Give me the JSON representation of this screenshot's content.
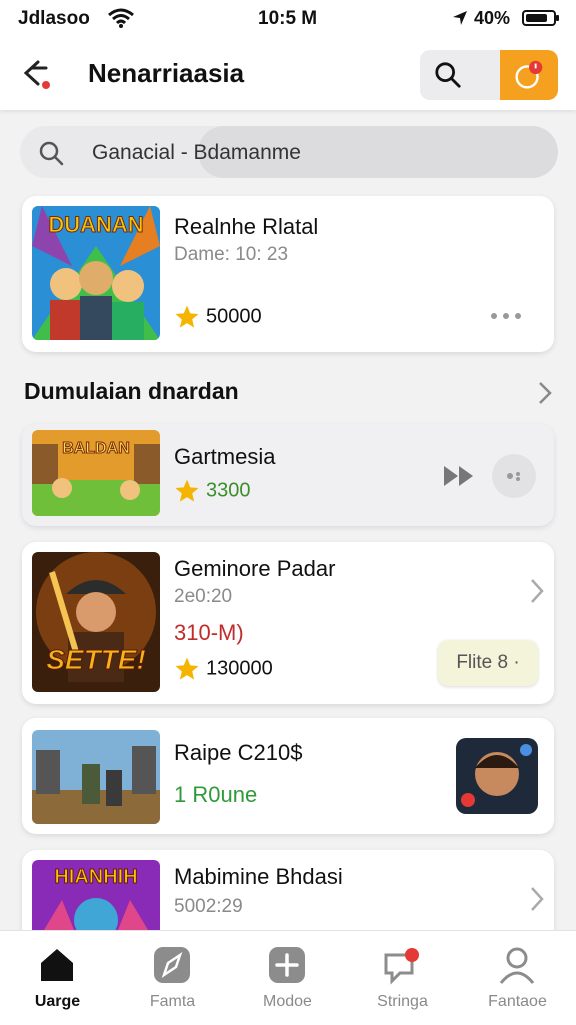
{
  "status_bar": {
    "carrier": "Jdlasoo",
    "time": "10:5 M",
    "battery": "40%",
    "battery_level": 0.8
  },
  "header": {
    "title": "Nenarriaasia"
  },
  "search": {
    "value": "Ganacial - Bdamanme"
  },
  "featured": {
    "title": "Realnhe Rlatal",
    "subtitle": "Dame: 10: 23",
    "rating": "50000",
    "thumb_banner": "DUANAN",
    "more_icon": "more-dots-icon"
  },
  "section": {
    "title": "Dumulaian dnardan"
  },
  "items": [
    {
      "title": "Gartmesia",
      "rating": "3300",
      "rating_color": "#3b8f2a",
      "thumb_text": "BALDAN"
    },
    {
      "title": "Geminore Padar",
      "subtitle": "2e0:20",
      "price": "310-M)",
      "rating": "130000",
      "button": "Flite 8 ·",
      "thumb_text": "SETTE!"
    },
    {
      "title": "Raipe C210$",
      "status": "1 R0une",
      "status_color": "#2f9a3a"
    },
    {
      "title": "Mabimine Bhdasi",
      "subtitle": "5002:29",
      "thumb_text": "HIANHIH"
    }
  ],
  "bottom_nav": [
    {
      "label": "Uarge",
      "icon": "home-icon",
      "active": true
    },
    {
      "label": "Famta",
      "icon": "compass-icon",
      "active": false
    },
    {
      "label": "Modoe",
      "icon": "plus-icon",
      "active": false
    },
    {
      "label": "Stringa",
      "icon": "chat-icon",
      "active": false
    },
    {
      "label": "Fantaoe",
      "icon": "profile-icon",
      "active": false
    }
  ],
  "colors": {
    "accent": "#f5a11f",
    "background": "#f2f2f3",
    "star": "#f4b400",
    "badge": "#e53935"
  }
}
